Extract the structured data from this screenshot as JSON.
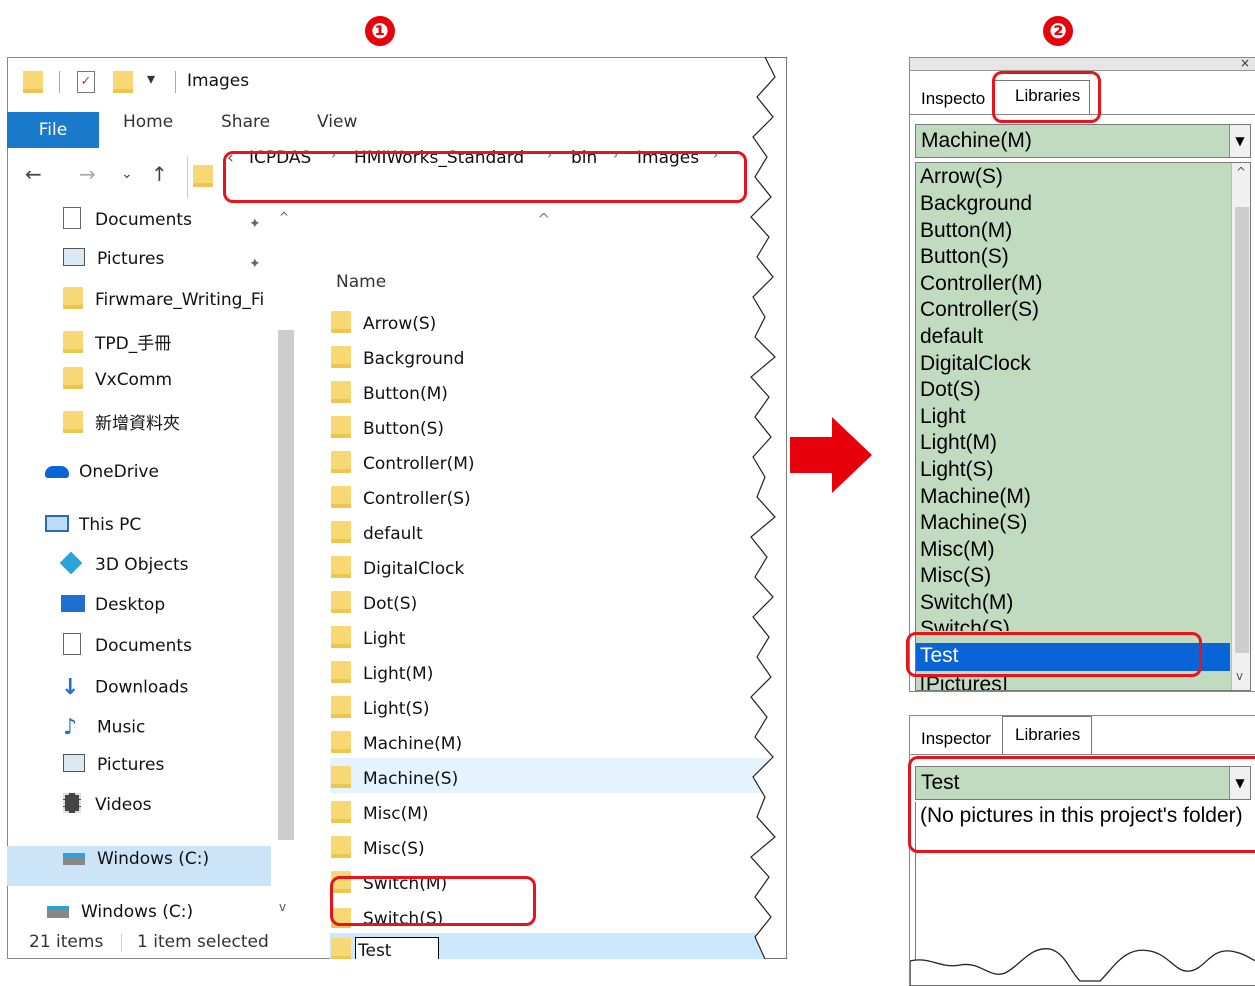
{
  "steps": [
    "❶",
    "❷"
  ],
  "explorer": {
    "title": "Images",
    "ribbon_tabs": {
      "file": "File",
      "home": "Home",
      "share": "Share",
      "view": "View"
    },
    "breadcrumb": [
      "ICPDAS",
      "HMIWorks_Standard",
      "bin",
      "Images"
    ],
    "sidebar": [
      {
        "label": "Documents",
        "icon": "documents-icon",
        "pinned": true
      },
      {
        "label": "Pictures",
        "icon": "pictures-icon",
        "pinned": true
      },
      {
        "label": "Firwmare_Writing_Fi",
        "icon": "folder-icon"
      },
      {
        "label": "TPD_手冊",
        "icon": "folder-icon"
      },
      {
        "label": "VxComm",
        "icon": "folder-icon"
      },
      {
        "label": "新增資料夾",
        "icon": "folder-icon"
      },
      {
        "label": "OneDrive",
        "icon": "onedrive-icon"
      },
      {
        "label": "This PC",
        "icon": "pc-icon"
      },
      {
        "label": "3D Objects",
        "icon": "3d-objects-icon"
      },
      {
        "label": "Desktop",
        "icon": "desktop-icon"
      },
      {
        "label": "Documents",
        "icon": "documents-icon"
      },
      {
        "label": "Downloads",
        "icon": "downloads-icon"
      },
      {
        "label": "Music",
        "icon": "music-icon"
      },
      {
        "label": "Pictures",
        "icon": "pictures-icon"
      },
      {
        "label": "Videos",
        "icon": "videos-icon"
      },
      {
        "label": "Windows (C:)",
        "icon": "drive-icon"
      },
      {
        "label": "Windows (C:)",
        "icon": "drive-icon"
      }
    ],
    "column_header": "Name",
    "files": [
      "Arrow(S)",
      "Background",
      "Button(M)",
      "Button(S)",
      "Controller(M)",
      "Controller(S)",
      "default",
      "DigitalClock",
      "Dot(S)",
      "Light",
      "Light(M)",
      "Light(S)",
      "Machine(M)",
      "Machine(S)",
      "Misc(M)",
      "Misc(S)",
      "Switch(M)",
      "Switch(S)",
      "Test"
    ],
    "status": {
      "items": "21 items",
      "selected": "1 item selected"
    }
  },
  "panel_top": {
    "tabs": {
      "inspector": "Inspecto",
      "libraries": "Libraries"
    },
    "combo_value": "Machine(M)",
    "items": [
      "Arrow(S)",
      "Background",
      "Button(M)",
      "Button(S)",
      "Controller(M)",
      "Controller(S)",
      "default",
      "DigitalClock",
      "Dot(S)",
      "Light",
      "Light(M)",
      "Light(S)",
      "Machine(M)",
      "Machine(S)",
      "Misc(M)",
      "Misc(S)",
      "Switch(M)",
      "Switch(S)",
      "Test",
      "[Pictures]"
    ],
    "selected_item": "Test"
  },
  "panel_bottom": {
    "tabs": {
      "inspector": "Inspector",
      "libraries": "Libraries"
    },
    "combo_value": "Test",
    "empty_message": "(No pictures in this project's folder)"
  },
  "colors": {
    "highlight_border": "#e8141b",
    "list_bg": "#c1dbc1",
    "selection": "#0a64d8",
    "file_tab": "#1979ca"
  }
}
